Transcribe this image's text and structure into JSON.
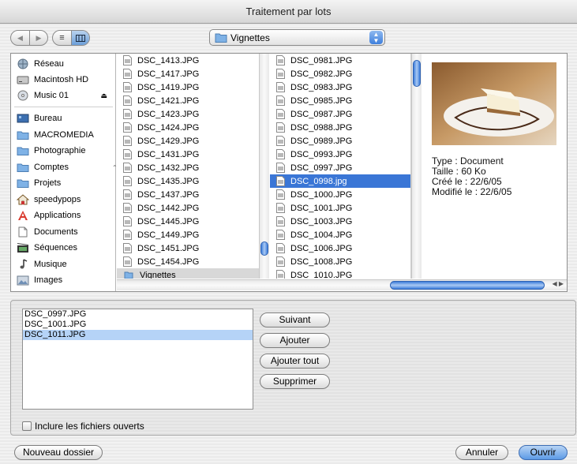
{
  "window": {
    "title": "Traitement par lots"
  },
  "toolbar": {
    "back_icon": "back-arrow-icon",
    "forward_icon": "forward-arrow-icon",
    "list_view_icon": "list-view-icon",
    "column_view_icon": "column-view-icon",
    "location": "Vignettes"
  },
  "sidebar": {
    "devices": [
      {
        "label": "Réseau",
        "icon": "network-icon"
      },
      {
        "label": "Macintosh HD",
        "icon": "hard-disk-icon"
      },
      {
        "label": "Music 01",
        "icon": "cd-icon"
      }
    ],
    "places": [
      {
        "label": "Bureau",
        "icon": "desktop-icon"
      },
      {
        "label": "MACROMEDIA",
        "icon": "folder-icon"
      },
      {
        "label": "Photographie",
        "icon": "folder-icon"
      },
      {
        "label": "Comptes",
        "icon": "folder-icon"
      },
      {
        "label": "Projets",
        "icon": "folder-icon"
      },
      {
        "label": "speedypops",
        "icon": "home-icon"
      },
      {
        "label": "Applications",
        "icon": "applications-icon"
      },
      {
        "label": "Documents",
        "icon": "documents-icon"
      },
      {
        "label": "Séquences",
        "icon": "movies-icon"
      },
      {
        "label": "Musique",
        "icon": "music-icon"
      },
      {
        "label": "Images",
        "icon": "pictures-icon"
      }
    ]
  },
  "column1": {
    "items": [
      "DSC_1413.JPG",
      "DSC_1417.JPG",
      "DSC_1419.JPG",
      "DSC_1421.JPG",
      "DSC_1423.JPG",
      "DSC_1424.JPG",
      "DSC_1429.JPG",
      "DSC_1431.JPG",
      "DSC_1432.JPG",
      "DSC_1435.JPG",
      "DSC_1437.JPG",
      "DSC_1442.JPG",
      "DSC_1445.JPG",
      "DSC_1449.JPG",
      "DSC_1451.JPG",
      "DSC_1454.JPG"
    ],
    "folder": "Vignettes"
  },
  "column2": {
    "items": [
      "DSC_0981.JPG",
      "DSC_0982.JPG",
      "DSC_0983.JPG",
      "DSC_0985.JPG",
      "DSC_0987.JPG",
      "DSC_0988.JPG",
      "DSC_0989.JPG",
      "DSC_0993.JPG",
      "DSC_0997.JPG",
      "DSC_0998.jpg",
      "DSC_1000.JPG",
      "DSC_1001.JPG",
      "DSC_1003.JPG",
      "DSC_1004.JPG",
      "DSC_1006.JPG",
      "DSC_1008.JPG",
      "DSC_1010.JPG"
    ],
    "selected_index": 9
  },
  "preview": {
    "type": "Type : Document",
    "size": "Taille : 60 Ko",
    "created": "Créé le : 22/6/05",
    "modified": "Modifié le : 22/6/05"
  },
  "batch": {
    "files": [
      "DSC_0997.JPG",
      "DSC_1001.JPG",
      "DSC_1011.JPG"
    ],
    "selected_index": 2,
    "next_label": "Suivant",
    "add_label": "Ajouter",
    "add_all_label": "Ajouter tout",
    "remove_label": "Supprimer",
    "include_open_label": "Inclure les fichiers ouverts"
  },
  "footer": {
    "new_folder_label": "Nouveau dossier",
    "cancel_label": "Annuler",
    "open_label": "Ouvrir"
  }
}
